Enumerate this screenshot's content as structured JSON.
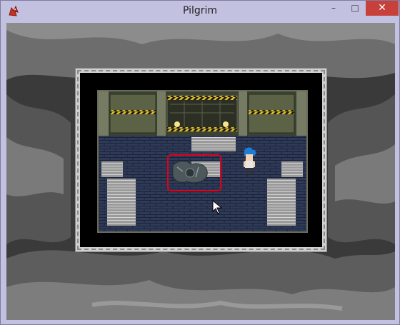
{
  "window": {
    "title": "Pilgrim",
    "app_icon": "red-dragon-icon",
    "controls": {
      "minimize": "–",
      "maximize": "□",
      "close": "✕"
    }
  },
  "scene": {
    "type": "rpg-tile-map",
    "background": "gray-rocky-cliffs",
    "room": "metal-industrial-room",
    "character": "blue-haired-hero",
    "highlight_color": "#e0001a",
    "highlighted_object": "broken-machine-debris"
  }
}
